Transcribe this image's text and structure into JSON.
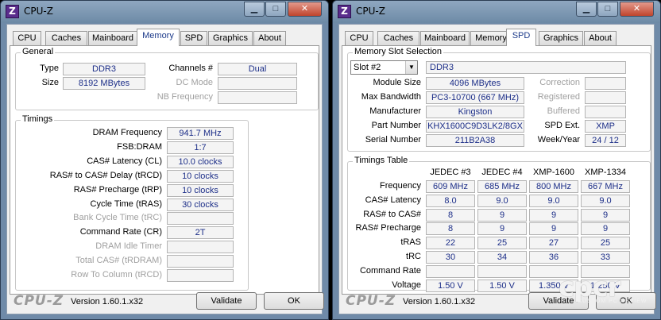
{
  "windows": [
    {
      "title": "CPU-Z",
      "tabs": [
        "CPU",
        "Caches",
        "Mainboard",
        "Memory",
        "SPD",
        "Graphics",
        "About"
      ],
      "active_tab": "Memory",
      "general": {
        "legend": "General",
        "type_label": "Type",
        "type_value": "DDR3",
        "size_label": "Size",
        "size_value": "8192 MBytes",
        "channels_label": "Channels #",
        "channels_value": "Dual",
        "dc_mode_label": "DC Mode",
        "dc_mode_value": "",
        "nb_freq_label": "NB Frequency",
        "nb_freq_value": ""
      },
      "timings": {
        "legend": "Timings",
        "rows": [
          {
            "label": "DRAM Frequency",
            "value": "941.7 MHz",
            "disabled": false
          },
          {
            "label": "FSB:DRAM",
            "value": "1:7",
            "disabled": false
          },
          {
            "label": "CAS# Latency (CL)",
            "value": "10.0 clocks",
            "disabled": false
          },
          {
            "label": "RAS# to CAS# Delay (tRCD)",
            "value": "10 clocks",
            "disabled": false
          },
          {
            "label": "RAS# Precharge (tRP)",
            "value": "10 clocks",
            "disabled": false
          },
          {
            "label": "Cycle Time (tRAS)",
            "value": "30 clocks",
            "disabled": false
          },
          {
            "label": "Bank Cycle Time (tRC)",
            "value": "",
            "disabled": true
          },
          {
            "label": "Command Rate (CR)",
            "value": "2T",
            "disabled": false
          },
          {
            "label": "DRAM Idle Timer",
            "value": "",
            "disabled": true
          },
          {
            "label": "Total CAS# (tRDRAM)",
            "value": "",
            "disabled": true
          },
          {
            "label": "Row To Column (tRCD)",
            "value": "",
            "disabled": true
          }
        ]
      },
      "footer": {
        "logo": "CPU-Z",
        "version": "Version 1.60.1.x32",
        "validate": "Validate",
        "ok": "OK"
      }
    },
    {
      "title": "CPU-Z",
      "tabs": [
        "CPU",
        "Caches",
        "Mainboard",
        "Memory",
        "SPD",
        "Graphics",
        "About"
      ],
      "active_tab": "SPD",
      "slot": {
        "legend": "Memory Slot Selection",
        "selected": "Slot #2",
        "type_value": "DDR3",
        "left_rows": [
          {
            "label": "Module Size",
            "value": "4096 MBytes"
          },
          {
            "label": "Max Bandwidth",
            "value": "PC3-10700 (667 MHz)"
          },
          {
            "label": "Manufacturer",
            "value": "Kingston"
          },
          {
            "label": "Part Number",
            "value": "KHX1600C9D3LK2/8GX"
          },
          {
            "label": "Serial Number",
            "value": "211B2A38"
          }
        ],
        "right_rows": [
          {
            "label": "Correction",
            "value": "",
            "disabled": true
          },
          {
            "label": "Registered",
            "value": "",
            "disabled": true
          },
          {
            "label": "Buffered",
            "value": "",
            "disabled": true
          },
          {
            "label": "SPD Ext.",
            "value": "XMP",
            "disabled": false
          },
          {
            "label": "Week/Year",
            "value": "24 / 12",
            "disabled": false
          }
        ]
      },
      "timings_table": {
        "legend": "Timings Table",
        "columns": [
          "JEDEC #3",
          "JEDEC #4",
          "XMP-1600",
          "XMP-1334"
        ],
        "rows": [
          {
            "label": "Frequency",
            "values": [
              "609 MHz",
              "685 MHz",
              "800 MHz",
              "667 MHz"
            ]
          },
          {
            "label": "CAS# Latency",
            "values": [
              "8.0",
              "9.0",
              "9.0",
              "9.0"
            ]
          },
          {
            "label": "RAS# to CAS#",
            "values": [
              "8",
              "9",
              "9",
              "9"
            ]
          },
          {
            "label": "RAS# Precharge",
            "values": [
              "8",
              "9",
              "9",
              "9"
            ]
          },
          {
            "label": "tRAS",
            "values": [
              "22",
              "25",
              "27",
              "25"
            ]
          },
          {
            "label": "tRC",
            "values": [
              "30",
              "34",
              "36",
              "33"
            ]
          },
          {
            "label": "Command Rate",
            "values": [
              "",
              "",
              "",
              ""
            ]
          },
          {
            "label": "Voltage",
            "values": [
              "1.50 V",
              "1.50 V",
              "1.350 V",
              "1.250 V"
            ]
          }
        ]
      },
      "footer": {
        "logo": "CPU-Z",
        "version": "Version 1.60.1.x32",
        "validate": "Validate",
        "ok": "OK"
      }
    }
  ],
  "watermark": {
    "text": "cpcr",
    "sub": "CUSTOM PC REVIEW"
  },
  "title_buttons": {
    "minimize": "▁",
    "maximize": "□",
    "close": "✕"
  }
}
